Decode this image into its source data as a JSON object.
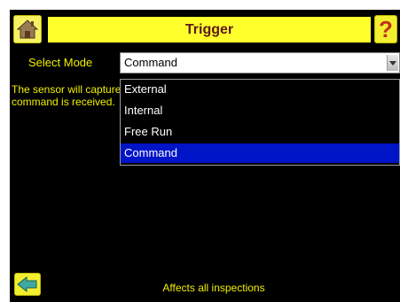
{
  "header": {
    "title": "Trigger",
    "help_glyph": "?",
    "home_icon": "home-icon",
    "help_icon": "help-icon"
  },
  "mode": {
    "label": "Select Mode",
    "value": "Command"
  },
  "description": "The sensor will capture an image when a command is received.",
  "dropdown": {
    "options": [
      "External",
      "Internal",
      "Free Run",
      "Command"
    ],
    "selected": "Command"
  },
  "footer": {
    "note": "Affects all inspections",
    "back_icon": "back-arrow-icon"
  },
  "colors": {
    "background": "#000000",
    "accent_yellow": "#ffff2b",
    "label_yellow": "#f0f000",
    "selection_blue": "#0014c8"
  }
}
